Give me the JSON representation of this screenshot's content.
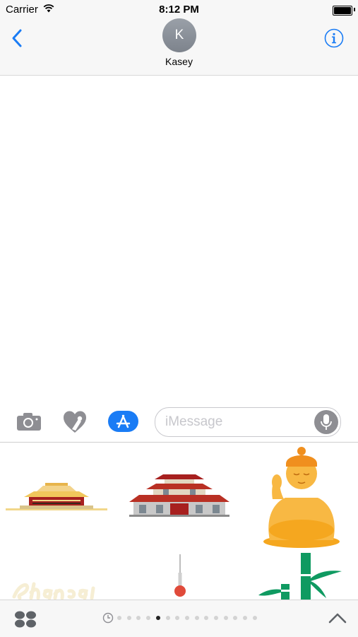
{
  "status_bar": {
    "carrier": "Carrier",
    "time": "8:12 PM"
  },
  "header": {
    "avatar_initial": "K",
    "contact_name": "Kasey"
  },
  "compose": {
    "placeholder": "iMessage",
    "value": ""
  },
  "stickers": [
    {
      "name": "forbidden-city-sticker"
    },
    {
      "name": "temple-sticker"
    },
    {
      "name": "buddha-sticker"
    },
    {
      "name": "shanghai-text-sticker"
    },
    {
      "name": "pearl-tower-sticker"
    },
    {
      "name": "bamboo-sticker"
    }
  ],
  "page_indicator": {
    "count": 15,
    "active_index": 4
  },
  "colors": {
    "accent": "#1a7cf5",
    "icon_gray": "#8e8e93",
    "buddha": "#f6a623"
  }
}
